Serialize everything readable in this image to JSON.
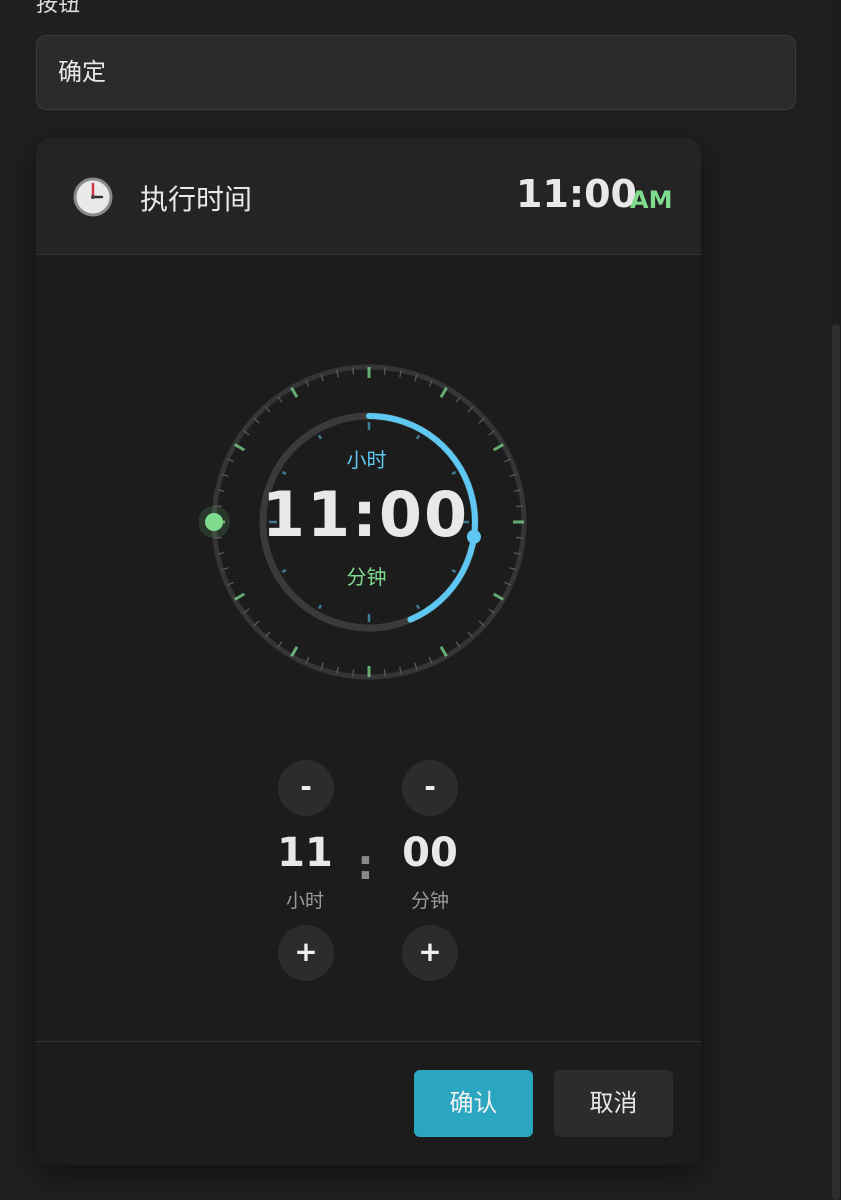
{
  "field": {
    "label": "按钮",
    "value": "确定"
  },
  "picker": {
    "title": "执行时间",
    "header_time": "11:00",
    "header_ampm": "AM",
    "dial": {
      "hour_label": "小时",
      "time": "11:00",
      "minute_label": "分钟",
      "hour_value": 11,
      "minute_value": 0
    },
    "stepper": {
      "hour_value": "11",
      "hour_label": "小时",
      "minute_value": "00",
      "minute_label": "分钟",
      "decrement_label": "-",
      "increment_label": "+",
      "separator": ":"
    },
    "actions": {
      "confirm_label": "确认",
      "cancel_label": "取消"
    }
  },
  "icons": {
    "header": "clock-icon"
  },
  "colors": {
    "hour_accent": "#5ec8f2",
    "minute_accent": "#7fdc8f",
    "confirm_button": "#2aa6c0",
    "background": "#1f1f1f",
    "panel": "#1c1c1c"
  }
}
